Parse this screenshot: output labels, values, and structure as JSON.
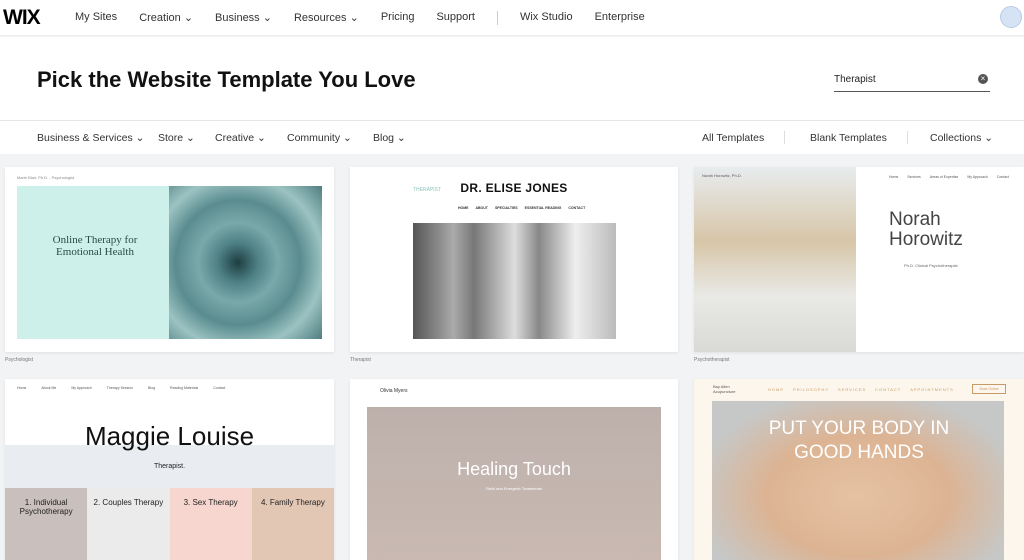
{
  "nav": {
    "logo": "WIX",
    "items": [
      "My Sites",
      "Creation",
      "Business",
      "Resources",
      "Pricing",
      "Support",
      "Wix Studio",
      "Enterprise"
    ]
  },
  "header": {
    "title": "Pick the Website Template You Love",
    "search_value": "Therapist"
  },
  "categories": {
    "left": [
      "Business & Services",
      "Store",
      "Creative",
      "Community",
      "Blog"
    ],
    "right": [
      "All Templates",
      "Blank Templates",
      "Collections"
    ]
  },
  "templates": [
    {
      "label": "Psychologist",
      "heading": "Online Therapy for Emotional Health",
      "site": "Marie Blair, Ph.D. - Psychologist"
    },
    {
      "label": "Therapist",
      "heading": "DR. ELISE JONES",
      "tag": "THERAPIST",
      "menu": [
        "HOME",
        "ABOUT",
        "SPECIALTIES",
        "ESSENTIAL READING",
        "CONTACT"
      ]
    },
    {
      "label": "Psychotherapist",
      "heading": "Norah Horowitz",
      "sub": "Ph.D. Clinical Psychotherapist",
      "site": "Norah Horowitz, Ph.D.",
      "menu": [
        "Home",
        "Services",
        "Areas of Expertise",
        "My Approach",
        "Contact"
      ]
    },
    {
      "heading": "Maggie Louise",
      "sub": "Therapist.",
      "services": [
        "1. Individual Psychotherapy",
        "2. Couples Therapy",
        "3. Sex Therapy",
        "4. Family Therapy"
      ],
      "menu": [
        "Home",
        "About Me",
        "My Approach",
        "Therapy Session",
        "Blog",
        "Reading Materials",
        "Contact"
      ]
    },
    {
      "heading": "Healing Touch",
      "site": "Olivia Myers",
      "sub": "Reiki and Energetic Treatments"
    },
    {
      "heading": "PUT YOUR BODY IN GOOD HANDS",
      "site": "Bay Allen Acupuncture",
      "menu": [
        "HOME",
        "PHILOSOPHY",
        "SERVICES",
        "CONTACT",
        "APPOINTMENTS"
      ],
      "button": "Book Online"
    }
  ]
}
